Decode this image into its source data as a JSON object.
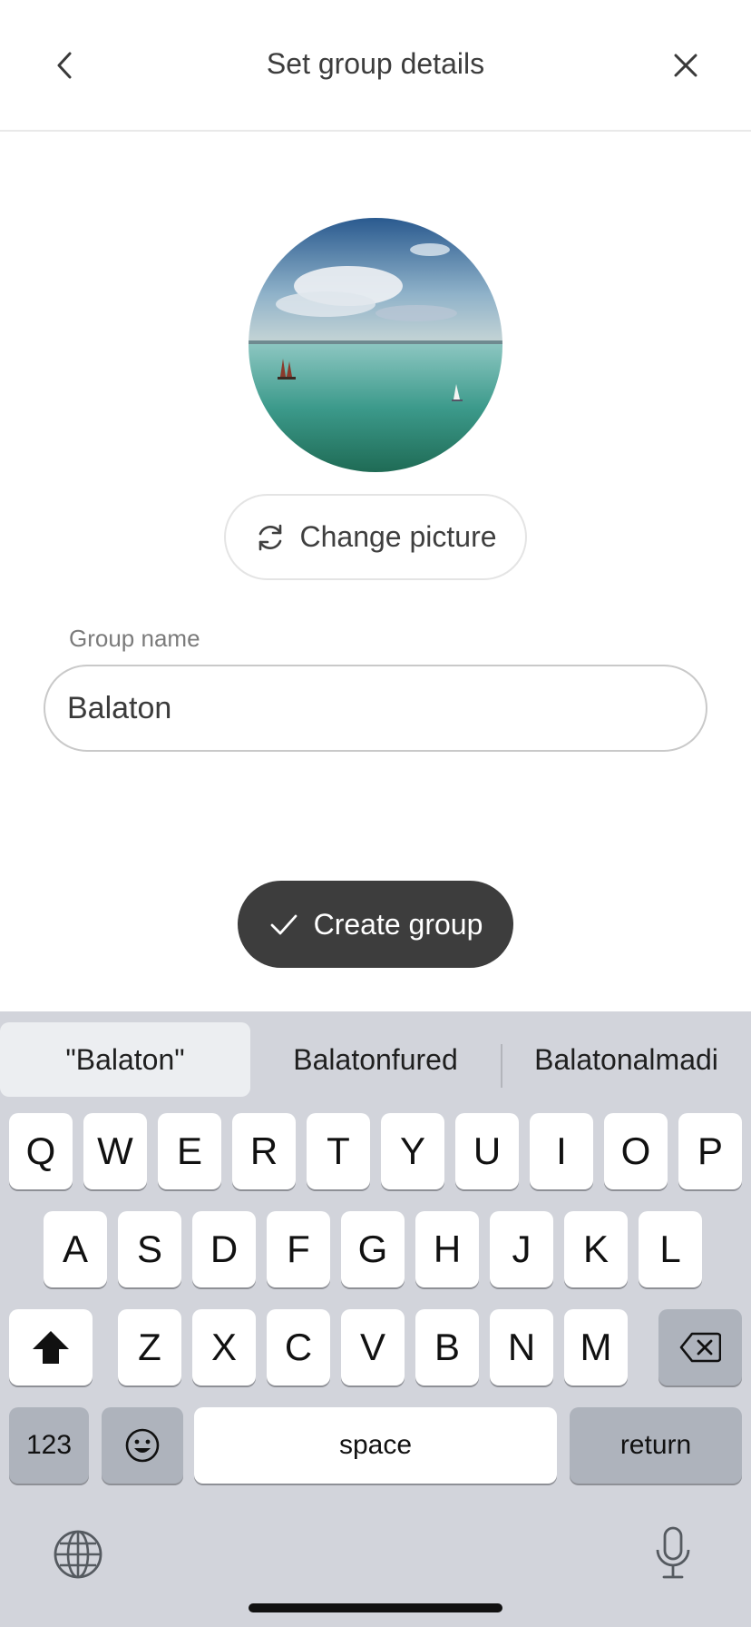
{
  "header": {
    "title": "Set group details",
    "back_icon": "chevron-left-icon",
    "close_icon": "close-icon"
  },
  "avatar": {
    "description_icon": "group-photo"
  },
  "change_picture": {
    "label": "Change picture",
    "icon": "refresh-icon"
  },
  "group_name": {
    "label": "Group name",
    "value": "Balaton"
  },
  "create_button": {
    "label": "Create group",
    "icon": "check-icon"
  },
  "keyboard": {
    "suggestions": [
      "\"Balaton\"",
      "Balatonfured",
      "Balatonalmadi"
    ],
    "row1": [
      "Q",
      "W",
      "E",
      "R",
      "T",
      "Y",
      "U",
      "I",
      "O",
      "P"
    ],
    "row2": [
      "A",
      "S",
      "D",
      "F",
      "G",
      "H",
      "J",
      "K",
      "L"
    ],
    "row3": [
      "Z",
      "X",
      "C",
      "V",
      "B",
      "N",
      "M"
    ],
    "numbers_label": "123",
    "space_label": "space",
    "return_label": "return"
  },
  "colors": {
    "primary_button": "#3d3d3d",
    "keyboard_bg": "#d2d4db",
    "key_bg": "#ffffff",
    "key_dark_bg": "#aeb3bc"
  }
}
